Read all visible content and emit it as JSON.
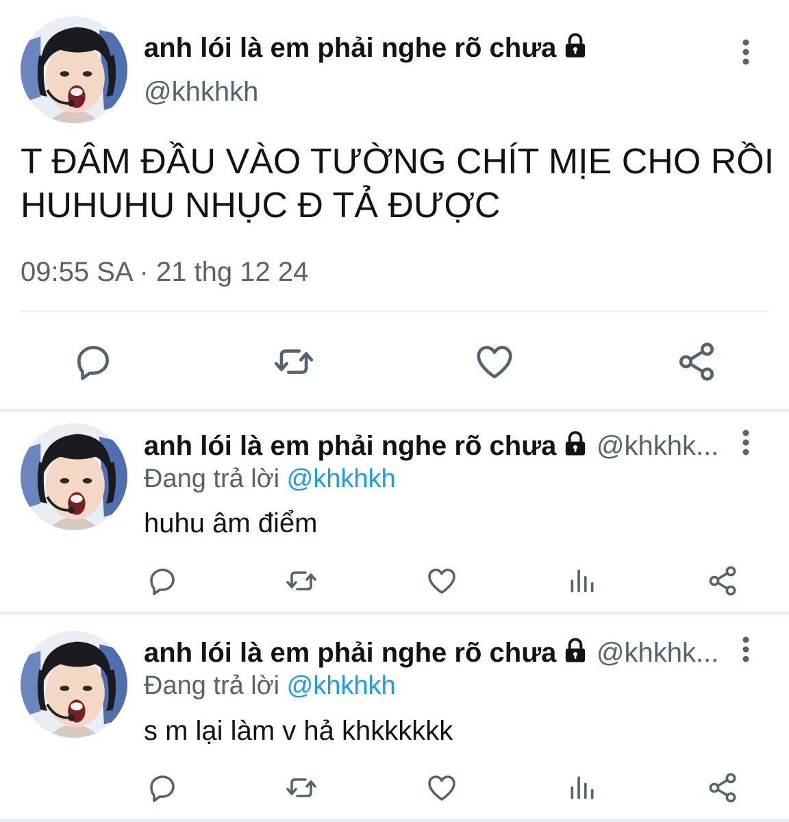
{
  "tweet": {
    "author_name": "anh lói là em phải nghe rõ chưa",
    "handle": "@khkhkh",
    "text_line1": "T ĐÂM ĐẦU VÀO TƯỜNG CHÍT MỊE CHO RỒI",
    "text_line2": "HUHUHU NHỤC Đ TẢ ĐƯỢC",
    "time": "09:55 SA",
    "separator": "·",
    "date": "21 thg 12 24",
    "actions": [
      "reply-icon",
      "retweet-icon",
      "like-icon",
      "share-icon"
    ]
  },
  "replies": [
    {
      "author_name": "anh lói là em phải nghe rõ chưa",
      "handle": "@khkhk...",
      "replying_label": "Đang trả lời",
      "replying_to": "@khkhkh",
      "text": "huhu âm điểm",
      "actions": [
        "reply-icon",
        "retweet-icon",
        "like-icon",
        "views-icon",
        "share-icon"
      ]
    },
    {
      "author_name": "anh lói là em phải nghe rõ chưa",
      "handle": "@khkhk...",
      "replying_label": "Đang trả lời",
      "replying_to": "@khkhkh",
      "text": "s m lại làm v hả khkkkkkk",
      "actions": [
        "reply-icon",
        "retweet-icon",
        "like-icon",
        "views-icon",
        "share-icon"
      ]
    }
  ],
  "colors": {
    "text": "#0f1419",
    "secondary": "#536471",
    "mention": "#1d9bf0",
    "divider": "#eff3f4"
  }
}
